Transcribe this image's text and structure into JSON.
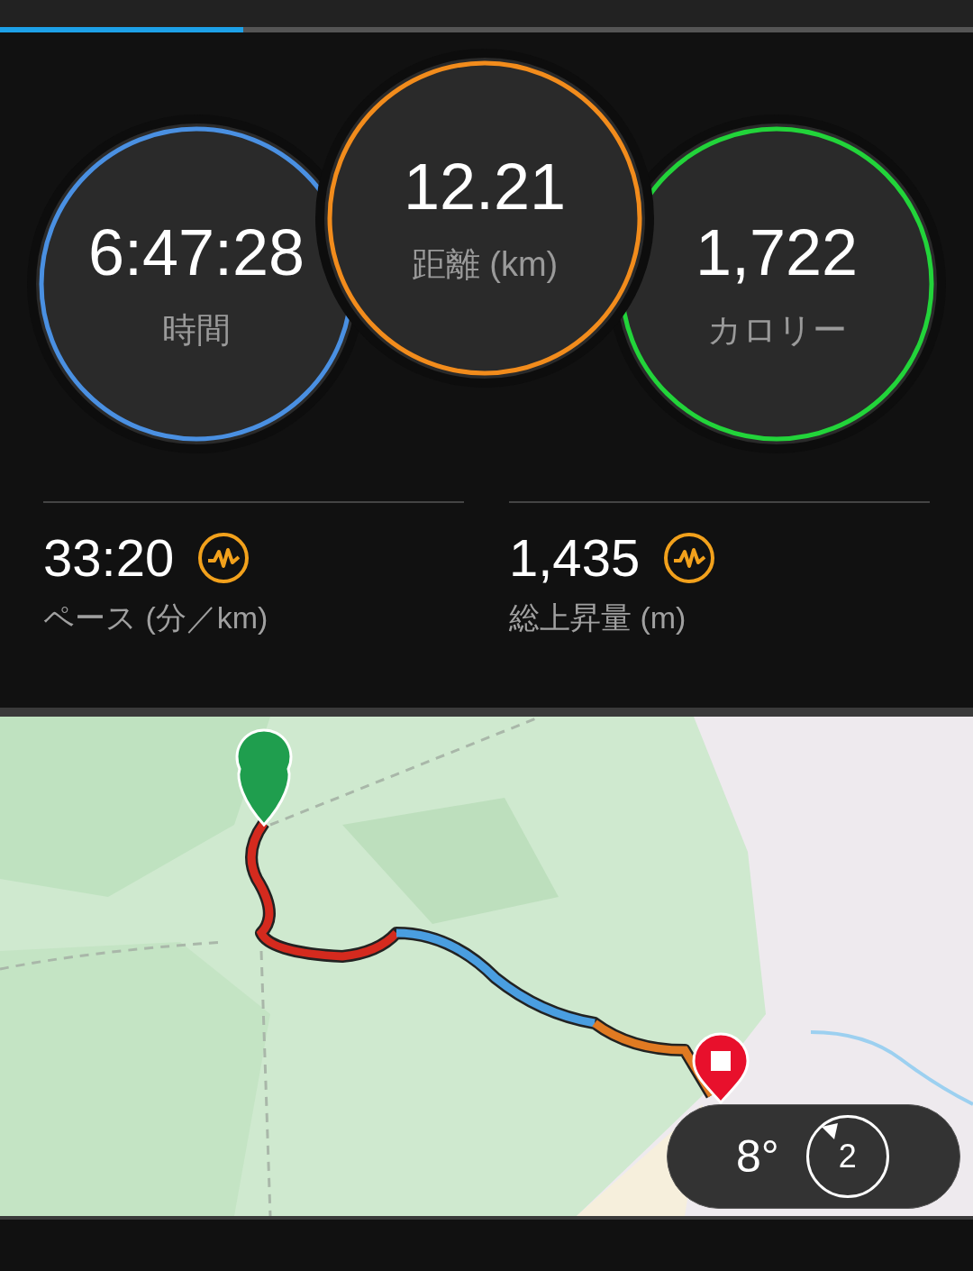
{
  "page_indicator": {
    "level": 0.25
  },
  "summary_rings": [
    {
      "value": "6:47:28",
      "label": "時間",
      "color": "#4a90e2"
    },
    {
      "value": "12.21",
      "label": "距離 (km)",
      "color": "#f28c1c"
    },
    {
      "value": "1,722",
      "label": "カロリー",
      "color": "#22d43a"
    }
  ],
  "stats": [
    {
      "value": "33:20",
      "label": "ペース (分／km)"
    },
    {
      "value": "1,435",
      "label": "総上昇量 (m)"
    }
  ],
  "map": {
    "kind": "picture",
    "weather": {
      "temperature": "8°",
      "wind": "2"
    }
  }
}
